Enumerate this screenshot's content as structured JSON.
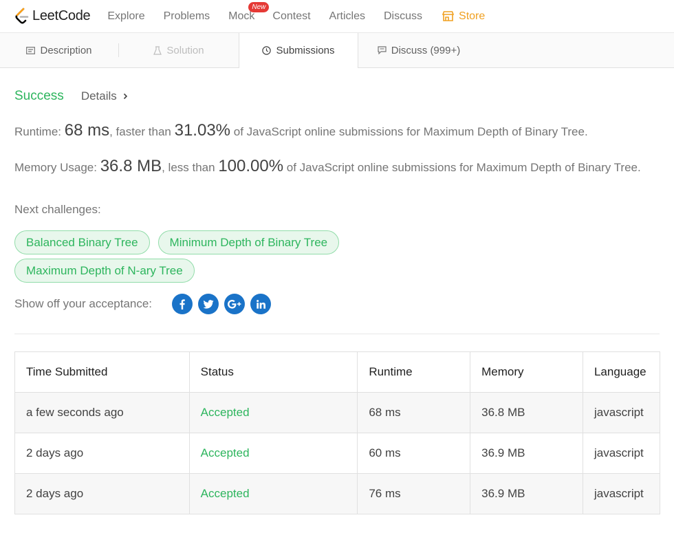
{
  "nav": {
    "logo_text": "LeetCode",
    "links": [
      "Explore",
      "Problems",
      "Mock",
      "Contest",
      "Articles",
      "Discuss"
    ],
    "new_badge": "New",
    "store": "Store",
    "accent_store": "#f0a020"
  },
  "tabs": {
    "description": "Description",
    "solution": "Solution",
    "submissions": "Submissions",
    "discuss": "Discuss (999+)"
  },
  "result": {
    "status": "Success",
    "details": "Details",
    "runtime_label": "Runtime: ",
    "runtime_value": "68 ms",
    "runtime_mid": ", faster than ",
    "runtime_pct": "31.03%",
    "runtime_tail": " of JavaScript online submissions for Maximum Depth of Binary Tree.",
    "memory_label": "Memory Usage: ",
    "memory_value": "36.8 MB",
    "memory_mid": ", less than ",
    "memory_pct": "100.00%",
    "memory_tail": " of JavaScript online submissions for Maximum Depth of Binary Tree.",
    "next_label": "Next challenges:",
    "challenges": [
      "Balanced Binary Tree",
      "Minimum Depth of Binary Tree",
      "Maximum Depth of N-ary Tree"
    ],
    "share_label": "Show off your acceptance:",
    "share_icons": [
      "facebook-icon",
      "twitter-icon",
      "google-plus-icon",
      "linkedin-icon"
    ],
    "success_color": "#2db55d"
  },
  "table": {
    "headers": [
      "Time Submitted",
      "Status",
      "Runtime",
      "Memory",
      "Language"
    ],
    "rows": [
      [
        "a few seconds ago",
        "Accepted",
        "68 ms",
        "36.8 MB",
        "javascript"
      ],
      [
        "2 days ago",
        "Accepted",
        "60 ms",
        "36.9 MB",
        "javascript"
      ],
      [
        "2 days ago",
        "Accepted",
        "76 ms",
        "36.9 MB",
        "javascript"
      ]
    ]
  }
}
